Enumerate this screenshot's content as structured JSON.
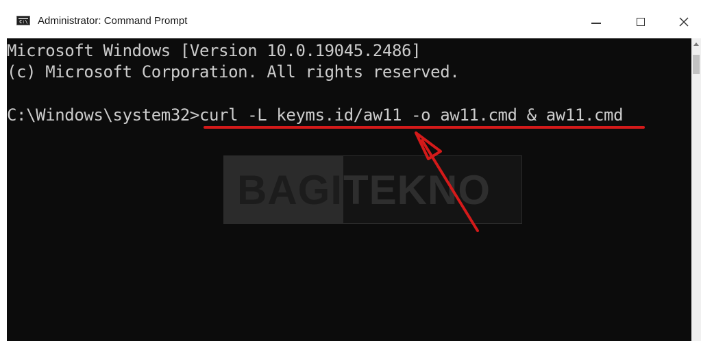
{
  "window": {
    "title": "Administrator: Command Prompt",
    "icon_label": "C:\\",
    "controls": {
      "minimize_icon": "minimize-icon",
      "maximize_icon": "maximize-icon",
      "close_glyph": "✕"
    }
  },
  "console": {
    "lines": [
      "Microsoft Windows [Version 10.0.19045.2486]",
      "(c) Microsoft Corporation. All rights reserved.",
      "C:\\Windows\\system32>curl -L keyms.id/aw11 -o aw11.cmd & aw11.cmd"
    ],
    "highlight_color": "#d41a1a"
  },
  "watermark": {
    "left": "BAGI",
    "right": "TEKNO"
  }
}
